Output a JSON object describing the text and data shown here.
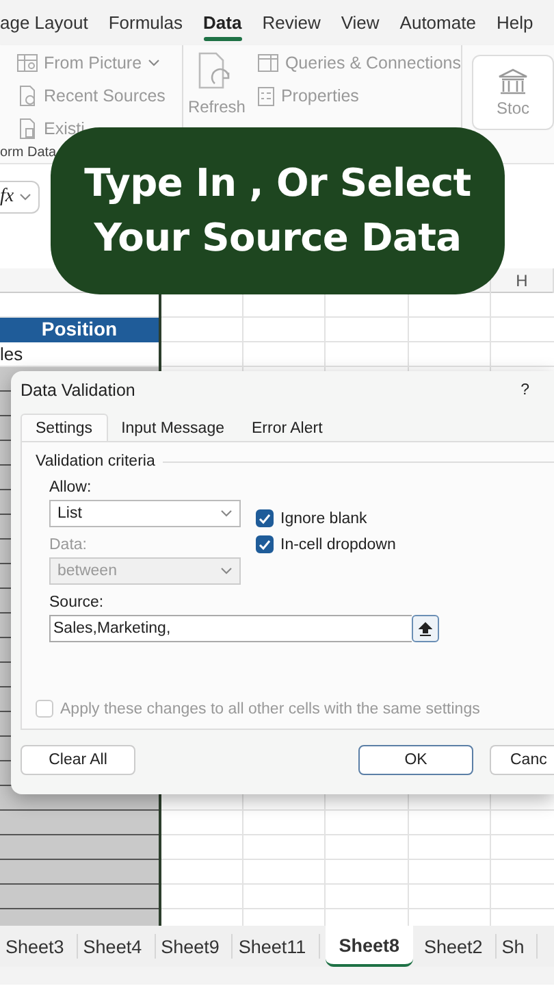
{
  "ribbon_tabs": [
    {
      "label": "age Layout",
      "selected": false
    },
    {
      "label": "Formulas",
      "selected": false
    },
    {
      "label": "Data",
      "selected": true
    },
    {
      "label": "Review",
      "selected": false
    },
    {
      "label": "View",
      "selected": false
    },
    {
      "label": "Automate",
      "selected": false
    },
    {
      "label": "Help",
      "selected": false
    }
  ],
  "ribbon": {
    "get_data_items": [
      "From Picture",
      "Recent Sources",
      "Existi"
    ],
    "group_label": "orm Data",
    "refresh_label": "Refresh",
    "query_items": [
      "Queries & Connections",
      "Properties"
    ],
    "stocks_label": "Stoc"
  },
  "formula_bar": {
    "fx": "fx"
  },
  "caption": "Type In , Or Select\nYour Source Data",
  "sheet": {
    "column_headers": [
      "H"
    ],
    "column_a": [
      {
        "text": "Position",
        "kind": "header"
      },
      {
        "text": "les",
        "kind": "cell"
      }
    ]
  },
  "dialog": {
    "title": "Data Validation",
    "help": "?",
    "tabs": [
      {
        "label": "Settings",
        "selected": true
      },
      {
        "label": "Input Message",
        "selected": false
      },
      {
        "label": "Error Alert",
        "selected": false
      }
    ],
    "section": "Validation criteria",
    "allow": {
      "label": "Allow:",
      "value": "List",
      "disabled": false
    },
    "data": {
      "label": "Data:",
      "value": "between",
      "disabled": true
    },
    "checkboxes": [
      {
        "label": "Ignore blank",
        "checked": true
      },
      {
        "label": "In-cell dropdown",
        "checked": true
      }
    ],
    "source": {
      "label": "Source:",
      "value": "Sales,Marketing,"
    },
    "apply": {
      "label": "Apply these changes to all other cells with the same settings",
      "checked": false,
      "disabled": true
    },
    "buttons": [
      {
        "label": "Clear All",
        "kind": "left"
      },
      {
        "label": "OK",
        "kind": "default"
      },
      {
        "label": "Canc",
        "kind": "plain"
      }
    ]
  },
  "sheet_tabs": [
    {
      "label": "Sheet3",
      "selected": false
    },
    {
      "label": "Sheet4",
      "selected": false
    },
    {
      "label": "Sheet9",
      "selected": false
    },
    {
      "label": "Sheet11",
      "selected": false
    },
    {
      "label": "Sheet8",
      "selected": true
    },
    {
      "label": "Sheet2",
      "selected": false
    },
    {
      "label": "Sh",
      "selected": false
    }
  ]
}
